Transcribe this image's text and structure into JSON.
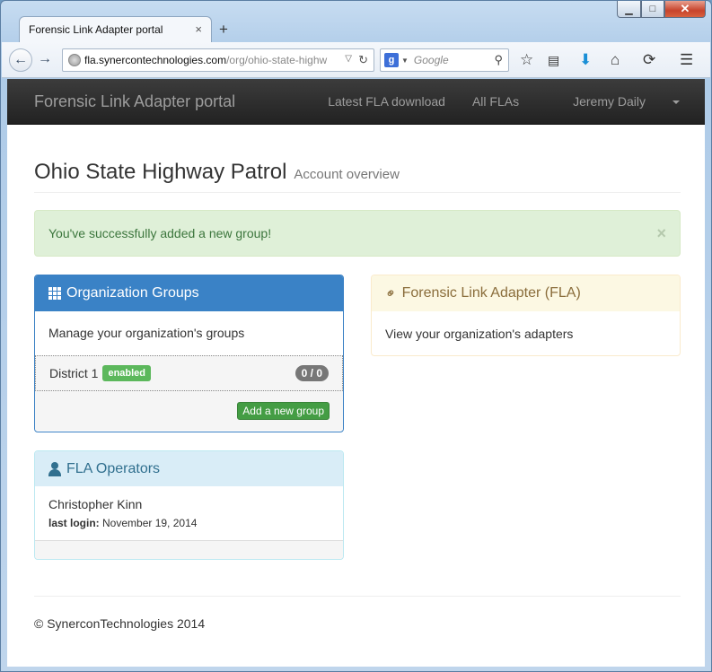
{
  "browser": {
    "tab_title": "Forensic Link Adapter portal",
    "tab_close": "×",
    "new_tab": "+",
    "url_domain": "fla.synercontechnologies.com",
    "url_path": "/org/ohio-state-highw",
    "search_placeholder": "Google",
    "window_controls": {
      "minimize": "▁",
      "maximize": "□",
      "close": "✕"
    }
  },
  "navbar": {
    "brand": "Forensic Link Adapter portal",
    "links": [
      "Latest FLA download",
      "All FLAs",
      "Jeremy Daily"
    ]
  },
  "header": {
    "title": "Ohio State Highway Patrol",
    "subtitle": "Account overview"
  },
  "alert": {
    "message": "You've successfully added a new group!",
    "close": "×"
  },
  "groups_panel": {
    "title": "Organization Groups",
    "description": "Manage your organization's groups",
    "items": [
      {
        "name": "District 1",
        "status": "enabled",
        "count": "0 / 0"
      }
    ],
    "add_button": "Add a new group"
  },
  "operators_panel": {
    "title": "FLA Operators",
    "operator_name": "Christopher Kinn",
    "last_login_label": "last login:",
    "last_login_value": "November 19, 2014"
  },
  "fla_panel": {
    "title": "Forensic Link Adapter (FLA)",
    "description": "View your organization's adapters"
  },
  "footer": {
    "copyright": "© SynerconTechnologies 2014"
  },
  "colors": {
    "primary": "#3a82c6",
    "success": "#5cb85c",
    "info_bg": "#d9edf7",
    "warning_bg": "#fcf8e3",
    "alert_bg": "#dff0d8"
  }
}
